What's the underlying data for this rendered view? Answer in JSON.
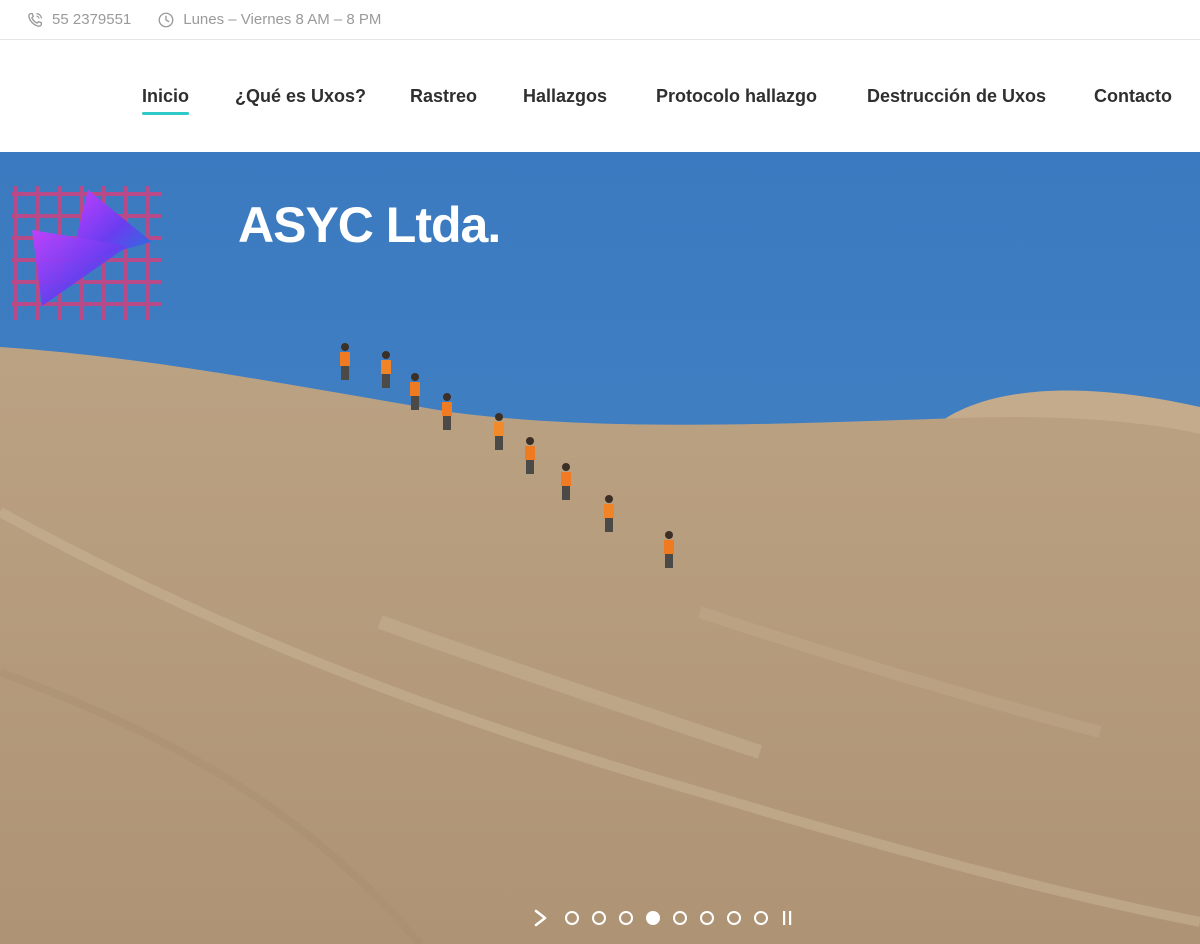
{
  "topbar": {
    "phone": "55 2379551",
    "phone_icon": "phone-icon",
    "hours": "Lunes – Viernes 8 AM – 8 PM",
    "hours_icon": "clock-icon"
  },
  "nav": {
    "items": [
      {
        "label": "Inicio",
        "active": true
      },
      {
        "label": "¿Qué es Uxos?"
      },
      {
        "label": "Rastreo"
      },
      {
        "label": "Hallazgos"
      },
      {
        "label": "Protocolo hallazgo"
      },
      {
        "label": "Destrucción de Uxos"
      },
      {
        "label": "Contacto"
      }
    ],
    "accent_color": "#2ec9c9"
  },
  "hero": {
    "title": "ASYC Ltda.",
    "sky_color": "#3f7dc0",
    "ground_color": "#b49b7c",
    "slides": {
      "count": 8,
      "active_index": 4
    },
    "next_icon": "chevron-right-icon",
    "pause_icon": "pause-icon"
  }
}
